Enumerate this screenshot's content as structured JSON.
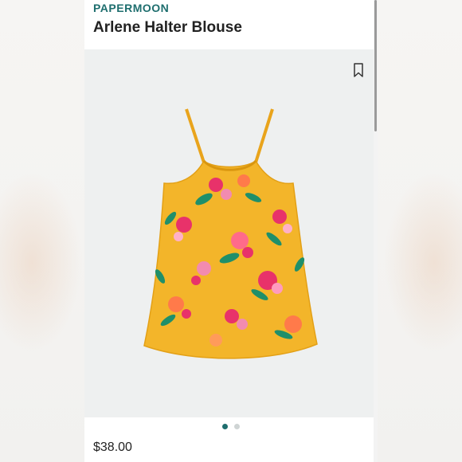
{
  "product": {
    "brand": "PAPERMOON",
    "name": "Arlene Halter Blouse",
    "price": "$38.00"
  },
  "gallery": {
    "image_count": 2,
    "active_index": 0
  },
  "icons": {
    "bookmark": "bookmark-icon"
  },
  "colors": {
    "brand_accent": "#1e6e6e",
    "blouse_base": "#f3b52a",
    "image_background": "#eef0f0"
  }
}
